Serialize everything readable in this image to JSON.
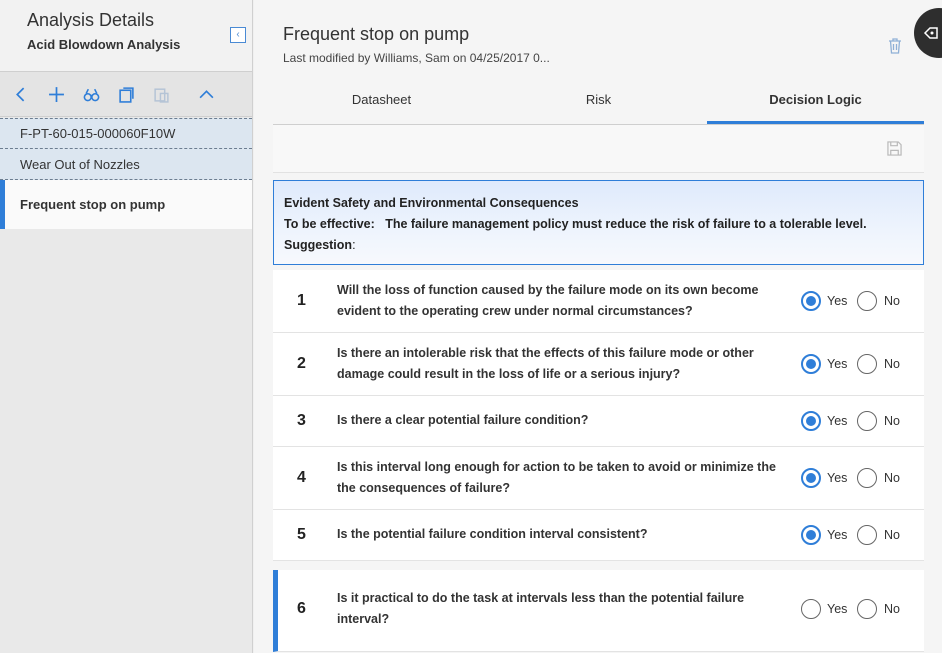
{
  "sidebar": {
    "title": "Analysis Details",
    "subtitle": "Acid Blowdown Analysis",
    "collapse_glyph": "‹",
    "toolbar_icons": [
      "back-icon",
      "add-icon",
      "binoculars-icon",
      "copy-icon",
      "paste-icon",
      "chevron-up-icon"
    ],
    "items": [
      {
        "label": "F-PT-60-015-000060F10W"
      },
      {
        "label": "Wear Out of Nozzles"
      },
      {
        "label": "Frequent stop on pump"
      }
    ]
  },
  "header": {
    "title": "Frequent stop on pump",
    "modified": "Last modified by Williams, Sam on 04/25/2017 0..."
  },
  "tabs": [
    {
      "label": "Datasheet"
    },
    {
      "label": "Risk"
    },
    {
      "label": "Decision Logic"
    }
  ],
  "active_tab": "Decision Logic",
  "info": {
    "heading": "Evident Safety and Environmental Consequences",
    "effective_label": "To be effective:",
    "effective_text": "The failure management policy must reduce the risk of failure to a tolerable level.",
    "suggestion_label": "Suggestion",
    "suggestion_colon": ":"
  },
  "radio_labels": {
    "yes": "Yes",
    "no": "No"
  },
  "questions": [
    {
      "num": "1",
      "line1": "Will the loss of function caused by the failure mode on its own become",
      "line2": "evident to the operating crew under normal circumstances?",
      "answer": "Yes"
    },
    {
      "num": "2",
      "line1": "Is there an intolerable risk that the effects of this failure mode or other",
      "line2": "damage could result in the loss of life or a serious injury?",
      "answer": "Yes"
    },
    {
      "num": "3",
      "line1": "Is there a clear potential failure condition?",
      "line2": "",
      "answer": "Yes"
    },
    {
      "num": "4",
      "line1": "Is this interval long enough for action to be taken to avoid or minimize the",
      "line2": "the consequences of failure?",
      "answer": "Yes"
    },
    {
      "num": "5",
      "line1": "Is the potential failure condition interval consistent?",
      "line2": "",
      "answer": "Yes"
    },
    {
      "num": "6",
      "line1": "Is it practical to do the task at intervals less than the potential failure",
      "line2": "interval?",
      "answer": ""
    }
  ],
  "colors": {
    "accent": "#2f7ed8",
    "sidebar_item_bg": "#dce6f0"
  }
}
